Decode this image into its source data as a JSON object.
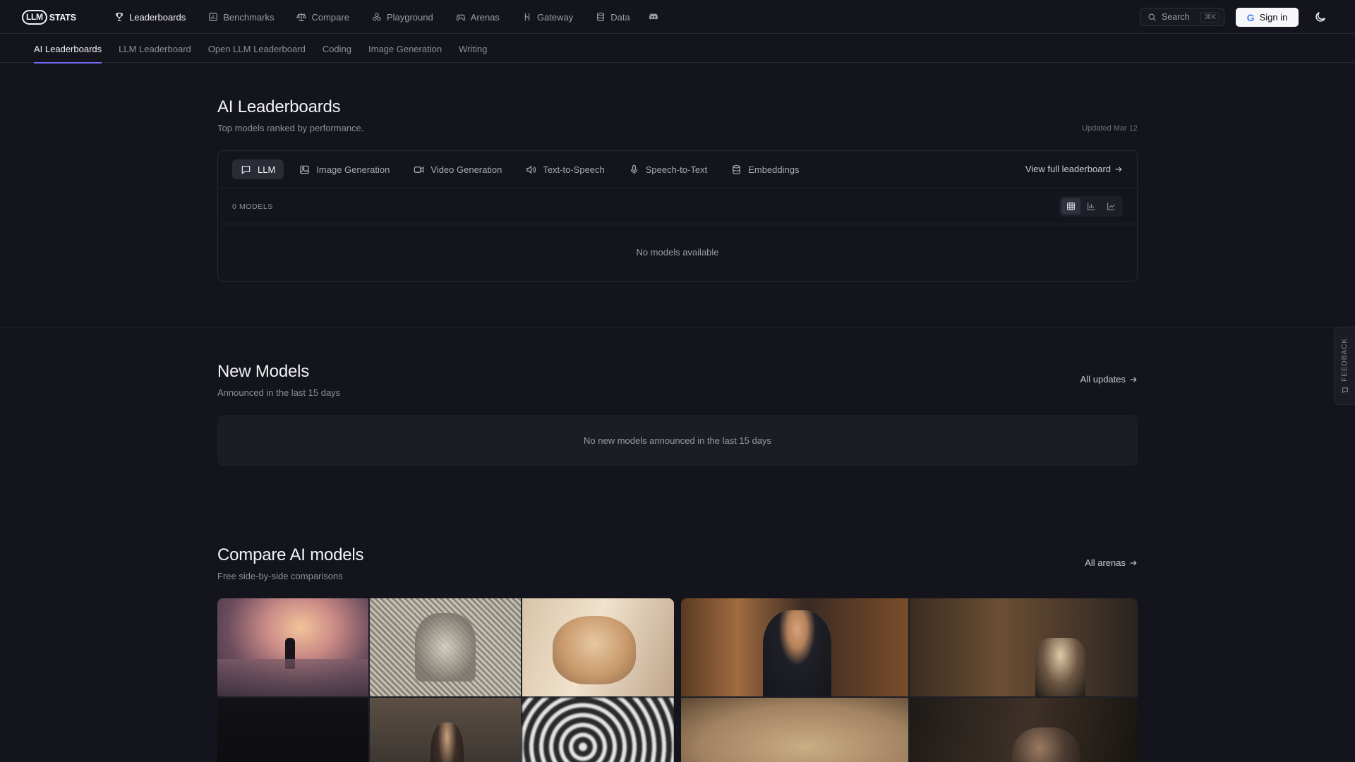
{
  "brand": {
    "badge": "LLM",
    "word": "STATS"
  },
  "nav": {
    "items": [
      {
        "label": "Leaderboards",
        "icon": "trophy-icon",
        "active": true
      },
      {
        "label": "Benchmarks",
        "icon": "bench-icon",
        "active": false
      },
      {
        "label": "Compare",
        "icon": "scale-icon",
        "active": false
      },
      {
        "label": "Playground",
        "icon": "flask-icon",
        "active": false
      },
      {
        "label": "Arenas",
        "icon": "gamepad-icon",
        "active": false
      },
      {
        "label": "Gateway",
        "icon": "gateway-icon",
        "active": false
      },
      {
        "label": "Data",
        "icon": "database-icon",
        "active": false
      }
    ],
    "discord_icon": "discord-icon"
  },
  "search": {
    "label": "Search",
    "shortcut": "⌘K"
  },
  "signin": {
    "label": "Sign in",
    "google_glyph": "G"
  },
  "subnav": {
    "tabs": [
      {
        "label": "AI Leaderboards",
        "active": true
      },
      {
        "label": "LLM Leaderboard",
        "active": false
      },
      {
        "label": "Open LLM Leaderboard",
        "active": false
      },
      {
        "label": "Coding",
        "active": false
      },
      {
        "label": "Image Generation",
        "active": false
      },
      {
        "label": "Writing",
        "active": false
      }
    ]
  },
  "leaderboards": {
    "title": "AI Leaderboards",
    "subtitle": "Top models ranked by performance.",
    "updated": "Updated Mar 12",
    "tabs": [
      {
        "label": "LLM",
        "icon": "chat-icon",
        "active": true
      },
      {
        "label": "Image Generation",
        "icon": "image-icon",
        "active": false
      },
      {
        "label": "Video Generation",
        "icon": "video-icon",
        "active": false
      },
      {
        "label": "Text-to-Speech",
        "icon": "speaker-icon",
        "active": false
      },
      {
        "label": "Speech-to-Text",
        "icon": "mic-icon",
        "active": false
      },
      {
        "label": "Embeddings",
        "icon": "database-icon",
        "active": false
      }
    ],
    "view_full": "View full leaderboard",
    "models_count": "0 MODELS",
    "empty": "No models available",
    "view_modes": [
      "table-view-icon",
      "bar-chart-icon",
      "scatter-chart-icon"
    ]
  },
  "new_models": {
    "title": "New Models",
    "subtitle": "Announced in the last 15 days",
    "link": "All updates",
    "empty": "No new models announced in the last 15 days"
  },
  "compare": {
    "title": "Compare AI models",
    "subtitle": "Free side-by-side comparisons",
    "link": "All arenas"
  },
  "feedback": {
    "label": "FEEDBACK"
  }
}
